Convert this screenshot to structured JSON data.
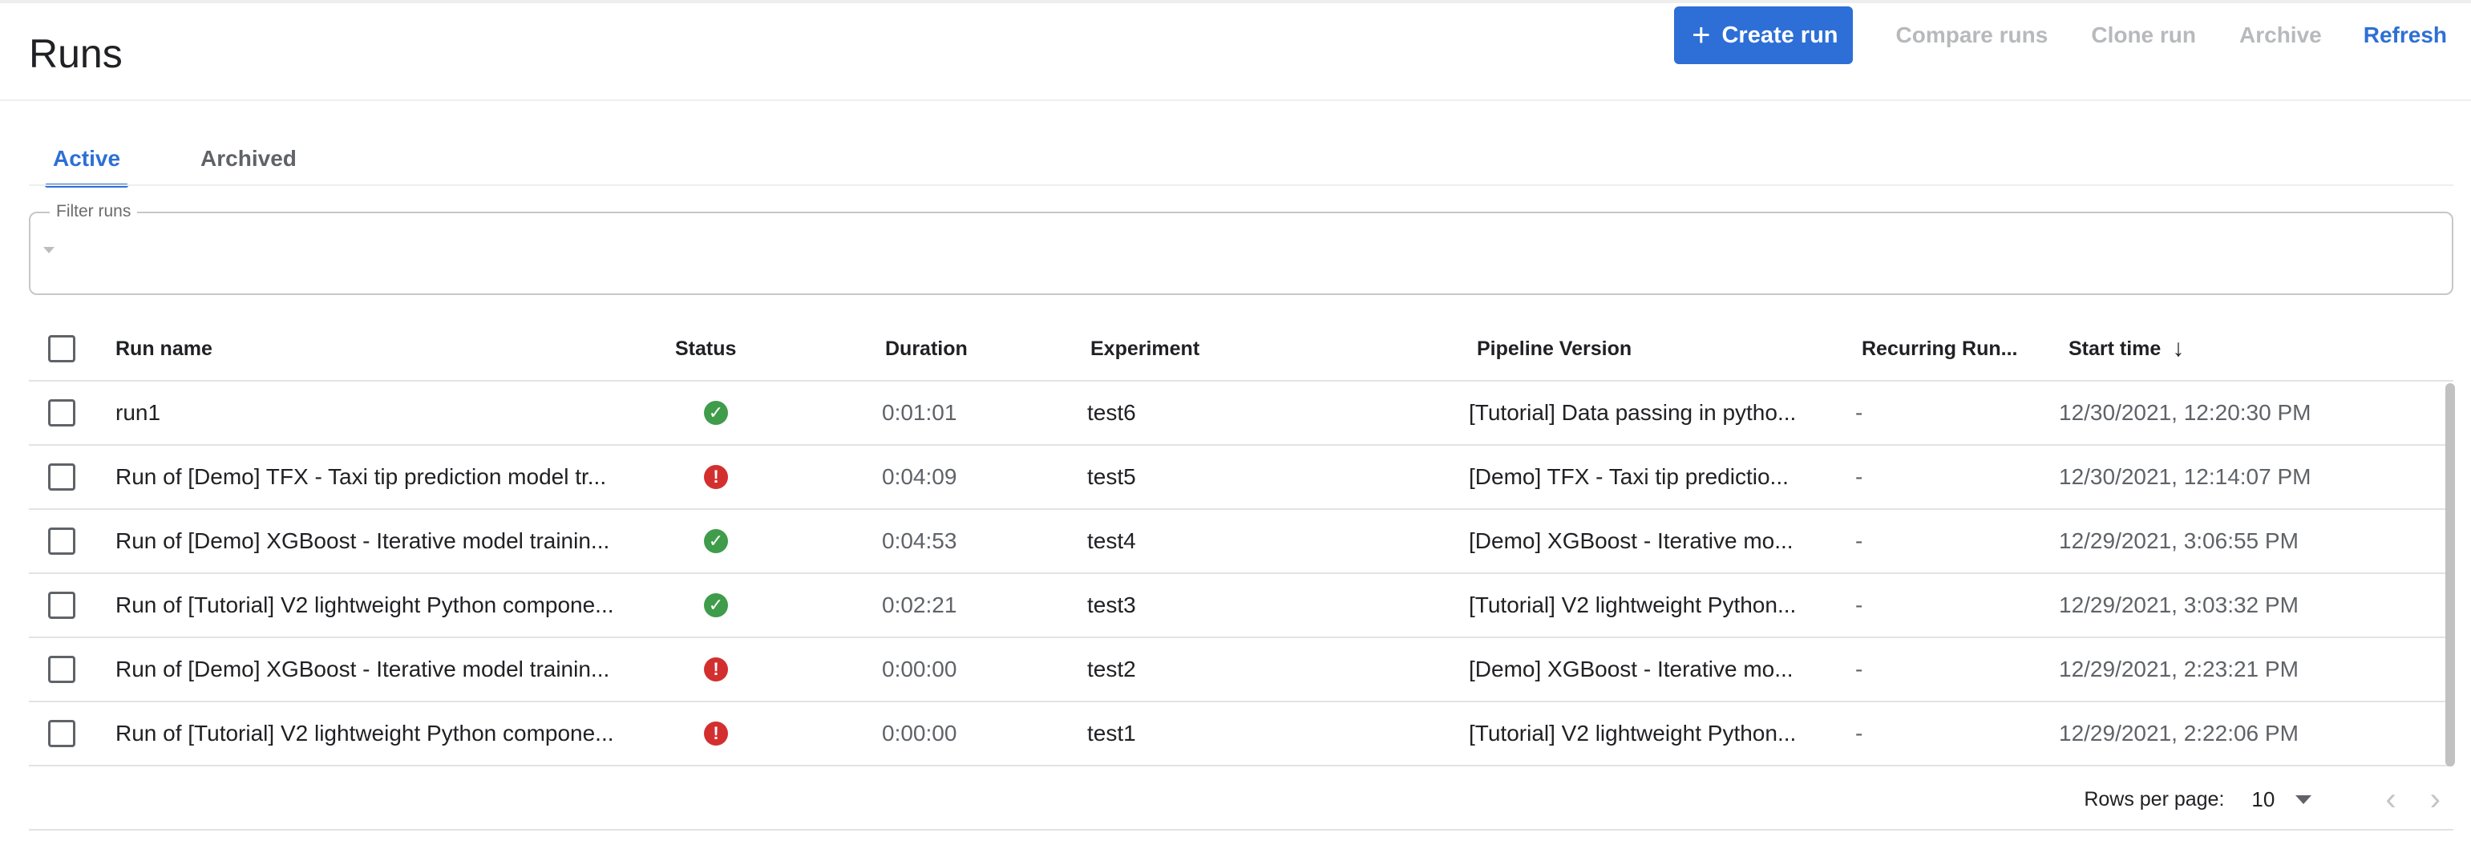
{
  "header": {
    "title": "Runs",
    "create_run": "Create run",
    "compare_runs": "Compare runs",
    "clone_run": "Clone run",
    "archive": "Archive",
    "refresh": "Refresh",
    "accent": "#2d6fd6"
  },
  "tabs": [
    {
      "label": "Active",
      "active": true
    },
    {
      "label": "Archived",
      "active": false
    }
  ],
  "filter": {
    "label": "Filter runs",
    "value": ""
  },
  "table": {
    "columns": {
      "run_name": "Run name",
      "status": "Status",
      "duration": "Duration",
      "experiment": "Experiment",
      "pipeline_version": "Pipeline Version",
      "recurring_run": "Recurring Run...",
      "start_time": "Start time"
    },
    "sort_icon": "arrow-down-icon",
    "rows": [
      {
        "name": "run1",
        "status": "success",
        "duration": "0:01:01",
        "experiment": "test6",
        "pipeline": "[Tutorial] Data passing in pytho...",
        "recurring": "-",
        "start": "12/30/2021, 12:20:30 PM"
      },
      {
        "name": "Run of [Demo] TFX - Taxi tip prediction model tr...",
        "status": "error",
        "duration": "0:04:09",
        "experiment": "test5",
        "pipeline": "[Demo] TFX - Taxi tip predictio...",
        "recurring": "-",
        "start": "12/30/2021, 12:14:07 PM"
      },
      {
        "name": "Run of [Demo] XGBoost - Iterative model trainin...",
        "status": "success",
        "duration": "0:04:53",
        "experiment": "test4",
        "pipeline": "[Demo] XGBoost - Iterative mo...",
        "recurring": "-",
        "start": "12/29/2021, 3:06:55 PM"
      },
      {
        "name": "Run of [Tutorial] V2 lightweight Python compone...",
        "status": "success",
        "duration": "0:02:21",
        "experiment": "test3",
        "pipeline": "[Tutorial] V2 lightweight Python...",
        "recurring": "-",
        "start": "12/29/2021, 3:03:32 PM"
      },
      {
        "name": "Run of [Demo] XGBoost - Iterative model trainin...",
        "status": "error",
        "duration": "0:00:00",
        "experiment": "test2",
        "pipeline": "[Demo] XGBoost - Iterative mo...",
        "recurring": "-",
        "start": "12/29/2021, 2:23:21 PM"
      },
      {
        "name": "Run of [Tutorial] V2 lightweight Python compone...",
        "status": "error",
        "duration": "0:00:00",
        "experiment": "test1",
        "pipeline": "[Tutorial] V2 lightweight Python...",
        "recurring": "-",
        "start": "12/29/2021, 2:22:06 PM"
      }
    ]
  },
  "pagination": {
    "rows_per_page_label": "Rows per page:",
    "rows_per_page": "10"
  },
  "colors": {
    "success": "#3f9c4a",
    "error": "#d32f2f",
    "disabled": "#b7b9bc"
  }
}
